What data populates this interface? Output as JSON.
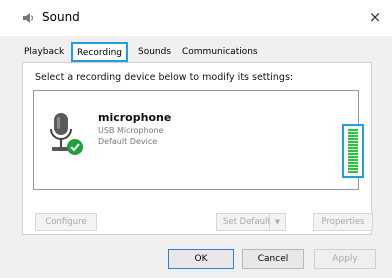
{
  "window": {
    "title": "Sound",
    "icon": "speaker-icon",
    "close_label": "×"
  },
  "tabs": [
    {
      "label": "Playback",
      "selected": false
    },
    {
      "label": "Recording",
      "selected": true
    },
    {
      "label": "Sounds",
      "selected": false
    },
    {
      "label": "Communications",
      "selected": false
    }
  ],
  "panel": {
    "instruction": "Select a recording device below to modify its settings:"
  },
  "device": {
    "name": "microphone",
    "description": "USB Microphone",
    "status": "Default Device",
    "icon": "microphone-icon",
    "badge_icon": "green-checkmark-icon",
    "level_fraction": 1.0,
    "level_color": "#2ec23e",
    "highlight_color": "#1f9fe0"
  },
  "buttons": {
    "configure": "Configure",
    "set_default": "Set Default",
    "set_default_arrow": "▼",
    "properties": "Properties",
    "ok": "OK",
    "cancel": "Cancel",
    "apply": "Apply"
  }
}
